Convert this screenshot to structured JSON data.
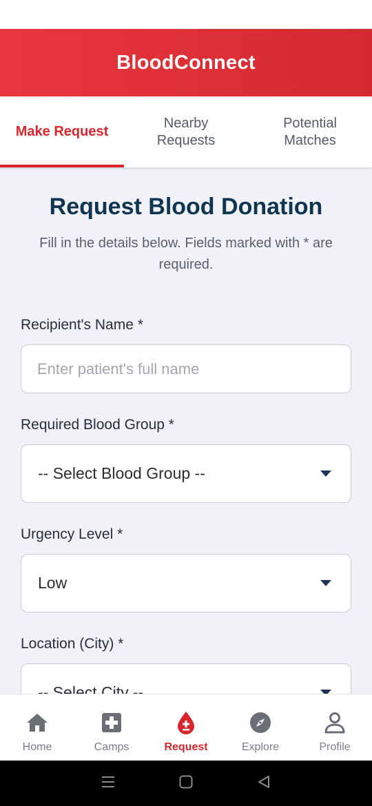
{
  "app": {
    "title": "BloodConnect"
  },
  "tabs": [
    {
      "label": "Make Request",
      "active": true
    },
    {
      "label": "Nearby\nRequests",
      "active": false
    },
    {
      "label": "Potential\nMatches",
      "active": false
    }
  ],
  "form": {
    "title": "Request Blood Donation",
    "subtitle": "Fill in the details below. Fields marked with * are required.",
    "recipient": {
      "label": "Recipient's Name *",
      "placeholder": "Enter patient's full name",
      "value": ""
    },
    "blood_group": {
      "label": "Required Blood Group *",
      "selected": "-- Select Blood Group --"
    },
    "urgency": {
      "label": "Urgency Level *",
      "selected": "Low"
    },
    "location": {
      "label": "Location (City) *",
      "selected": "-- Select City --"
    }
  },
  "bottom_nav": [
    {
      "label": "Home",
      "icon": "home-icon",
      "active": false
    },
    {
      "label": "Camps",
      "icon": "medical-cross-icon",
      "active": false
    },
    {
      "label": "Request",
      "icon": "blood-drop-icon",
      "active": true
    },
    {
      "label": "Explore",
      "icon": "compass-icon",
      "active": false
    },
    {
      "label": "Profile",
      "icon": "person-icon",
      "active": false
    }
  ],
  "colors": {
    "primary": "#d9262d",
    "header_gradient_start": "#e8363f",
    "title_navy": "#0f3550",
    "background": "#f0f2f7",
    "nav_inactive": "#7a7d85"
  }
}
